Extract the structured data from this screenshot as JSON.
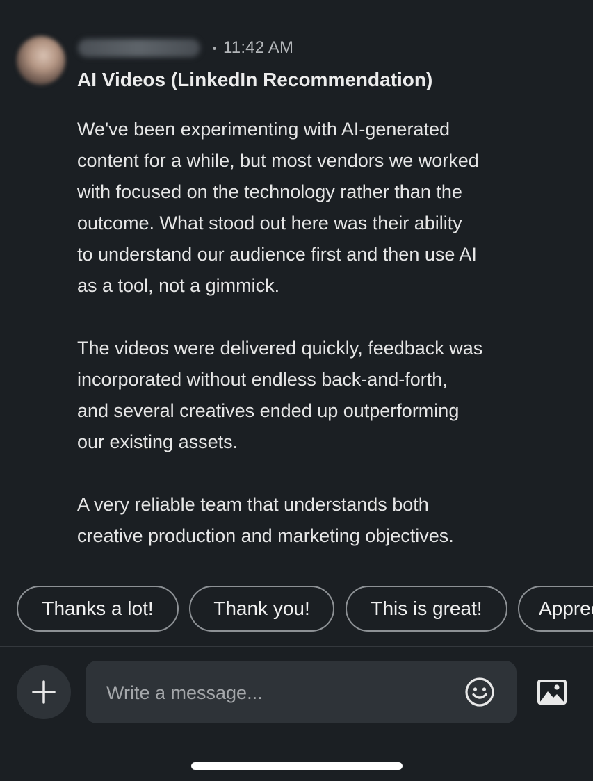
{
  "message": {
    "timestamp": "11:42 AM",
    "subject": "AI Videos (LinkedIn Recommendation)",
    "paragraphs": [
      "We've been experimenting with AI-generated\ncontent for a while, but most vendors we worked\nwith focused on the technology rather than the\noutcome. What stood out here was their ability\nto understand our audience first and then use AI\nas a tool, not a gimmick.",
      "The videos were delivered quickly, feedback was\nincorporated without endless back-and-forth,\nand several creatives ended up outperforming\nour existing assets.",
      "A very reliable team that understands both\ncreative production and marketing objectives."
    ]
  },
  "quick_replies": [
    "Thanks a lot!",
    "Thank you!",
    "This is great!",
    "Appreciate it!"
  ],
  "composer": {
    "placeholder": "Write a message...",
    "plus_icon": "plus-icon",
    "emoji_icon": "smiley-icon",
    "image_icon": "image-icon"
  },
  "colors": {
    "background": "#1b1f23",
    "input_background": "#2e3338",
    "chip_border": "#8d9195"
  }
}
